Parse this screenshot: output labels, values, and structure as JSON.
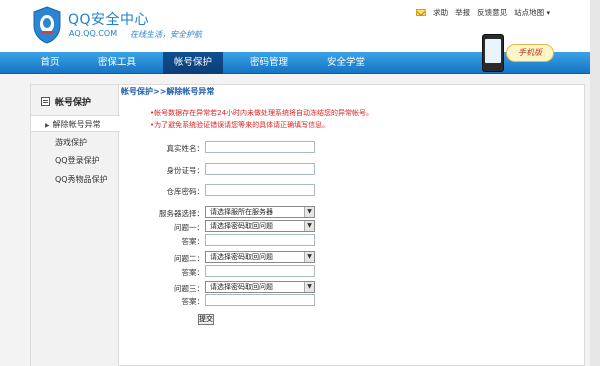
{
  "header": {
    "brand_title": "QQ安全中心",
    "brand_domain": "AQ.QQ.COM",
    "brand_slogan": "在线生活，安全护航",
    "links": [
      "求助",
      "举报",
      "反馈意见",
      "站点地图"
    ],
    "phone_badge": "手机版"
  },
  "nav": {
    "items": [
      "首页",
      "密保工具",
      "帐号保护",
      "密码管理",
      "安全学堂"
    ],
    "active_index": 2
  },
  "sidebar": {
    "title": "帐号保护",
    "items": [
      "解除帐号异常",
      "游戏保护",
      "QQ登录保护",
      "QQ秀物品保护"
    ],
    "active_index": 0
  },
  "main": {
    "breadcrumb": "帐号保护>>解除帐号异常",
    "notices": [
      "•帐号数据存在异常若24小时内未做处理系统将自动冻结您的异常帐号。",
      "•为了避免系统验证错误请您等来的具体请正确填写信息。"
    ],
    "fields": {
      "real_name": "真实姓名：",
      "id_number": "身份证号：",
      "warehouse_password": "仓库密码：",
      "server_select": "服务器选择：",
      "question1": "问题一：",
      "answer1": "答案：",
      "question2": "问题二：",
      "answer2": "答案：",
      "question3": "问题三：",
      "answer3": "答案："
    },
    "server_select_value": "请选择服所在服务器",
    "question_select_value": "请选择密码取回问题",
    "submit_label": "提交"
  }
}
